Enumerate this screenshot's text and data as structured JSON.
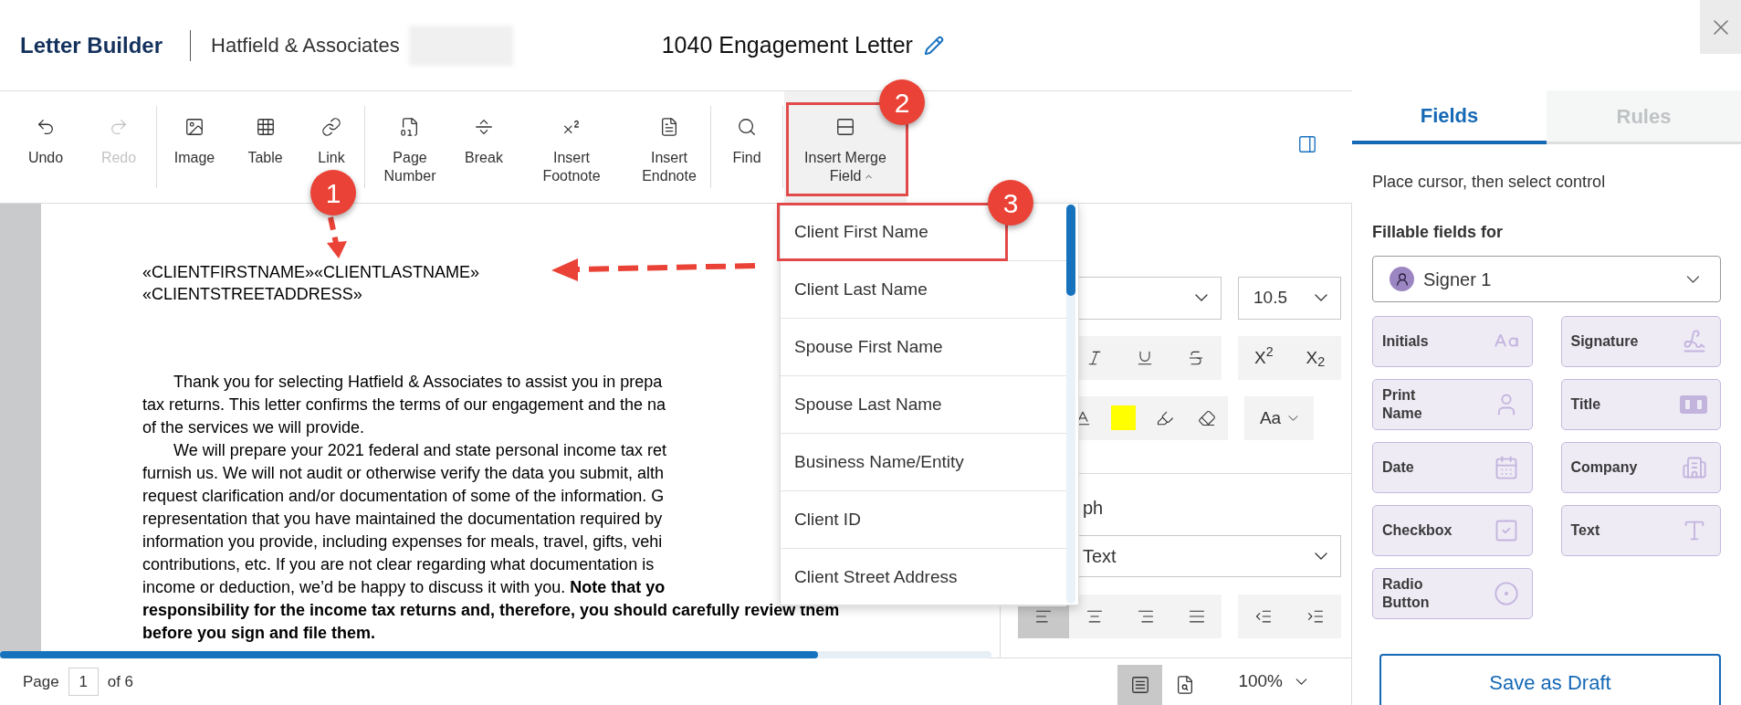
{
  "header": {
    "app_name": "Letter Builder",
    "company": "Hatfield & Associates",
    "title": "1040 Engagement Letter"
  },
  "toolbar": {
    "groups": [
      {
        "items": [
          {
            "label": "Undo",
            "disabled": false
          },
          {
            "label": "Redo",
            "disabled": true
          }
        ]
      },
      {
        "items": [
          {
            "label": "Image",
            "disabled": false
          },
          {
            "label": "Table",
            "disabled": false
          },
          {
            "label": "Link",
            "disabled": false
          }
        ]
      },
      {
        "items": [
          {
            "label": "Page Number",
            "disabled": false
          },
          {
            "label": "Break",
            "disabled": false
          },
          {
            "label": "Insert Footnote",
            "disabled": false
          },
          {
            "label": "Insert Endnote",
            "disabled": false
          }
        ]
      },
      {
        "items": [
          {
            "label": "Find",
            "disabled": false
          }
        ]
      },
      {
        "items": [
          {
            "label": "Insert Merge Field",
            "disabled": false,
            "expanded": true
          }
        ]
      }
    ]
  },
  "merge_menu": {
    "items": [
      "Client First Name",
      "Client Last Name",
      "Spouse First Name",
      "Spouse Last Name",
      "Business Name/Entity",
      "Client ID",
      "Client Street Address"
    ]
  },
  "document": {
    "merge_lines": [
      "«CLIENTFIRSTNAME»«CLIENTLASTNAME»",
      "«CLIENTSTREETADDRESS»"
    ],
    "paragraphs": [
      {
        "lines": [
          "Thank you for selecting Hatfield & Associates to assist you in prepa",
          "tax returns. This letter confirms the terms of our engagement and the na",
          "of the services we will provide."
        ]
      },
      {
        "lines": [
          "We will prepare your 2021 federal and state personal income tax ret",
          "furnish us. We will not audit or otherwise verify the data you submit, alth",
          "request clarification and/or documentation of some of the information. G",
          "representation that you have maintained the documentation required by",
          "information you provide, including expenses for meals, travel, gifts, vehi",
          "contributions, etc. If you are not clear regarding what documentation is",
          "income or deduction, we’d be happy to discuss it with you. **Note that yo**",
          "**responsibility for the income tax returns and, therefore, you should carefully review them**",
          "**before you sign and file them.**"
        ]
      }
    ]
  },
  "format_panel": {
    "font_size": "10.5",
    "script_buttons": [
      "X$^{2}$",
      "X$_{2}$"
    ],
    "case_button": "Aa",
    "section_heading": "ph",
    "paragraph_style": "Text",
    "align_buttons": [
      {
        "selected": true
      },
      {
        "selected": false
      },
      {
        "selected": false
      },
      {
        "selected": false
      }
    ]
  },
  "status_bar": {
    "page_label": "Page",
    "page": "1",
    "of_label": "of 6",
    "view_buttons": [
      {
        "selected": true
      },
      {
        "selected": false
      }
    ],
    "zoom": "100%"
  },
  "sidebar": {
    "tabs": [
      {
        "label": "Fields",
        "selected": true
      },
      {
        "label": "Rules",
        "selected": false
      }
    ],
    "instruction": "Place cursor, then select control",
    "fields_label": "Fillable fields for",
    "signer": "Signer 1",
    "fields": [
      "Initials",
      "Signature",
      "Print Name",
      "Title",
      "Date",
      "Company",
      "Checkbox",
      "Text",
      "Radio Button"
    ],
    "save_button": "Save as Draft"
  },
  "annotations": [
    "1",
    "2",
    "3"
  ]
}
